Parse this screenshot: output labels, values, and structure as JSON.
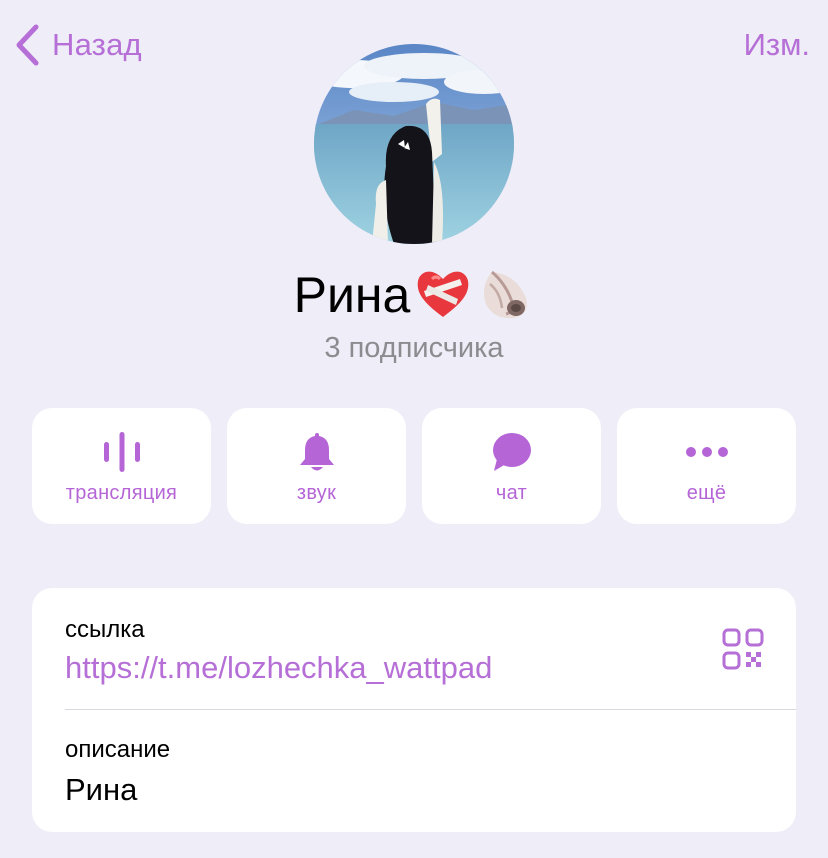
{
  "nav": {
    "back_label": "Назад",
    "edit_label": "Изм."
  },
  "profile": {
    "name": "Рина",
    "subscribers": "3 подписчика",
    "avatar_icon": "avatar-photo-girl-by-sea"
  },
  "actions": [
    {
      "label": "трансляция",
      "icon": "live-stream-icon"
    },
    {
      "label": "звук",
      "icon": "bell-icon"
    },
    {
      "label": "чат",
      "icon": "chat-bubble-icon"
    },
    {
      "label": "ещё",
      "icon": "more-dots-icon"
    }
  ],
  "info": {
    "link_label": "ссылка",
    "link_value": "https://t.me/lozhechka_wattpad",
    "description_label": "описание",
    "description_value": "Рина"
  },
  "colors": {
    "accent": "#b56fd6",
    "background": "#efedf7",
    "card": "#ffffff",
    "secondary_text": "#8c8c90"
  }
}
